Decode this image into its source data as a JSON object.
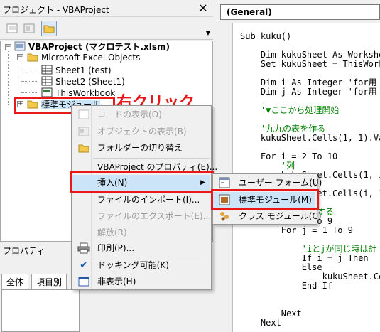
{
  "project_explorer": {
    "title": "プロジェクト - VBAProject",
    "close_glyph": "✕",
    "tree": {
      "root": "VBAProject (マクロテスト.xlsm)",
      "excel_objects_folder": "Microsoft Excel Objects",
      "sheet1": "Sheet1 (test)",
      "sheet2": "Sheet2 (Sheet1)",
      "thisworkbook": "ThisWorkbook",
      "standard_module_folder": "標準モジュール"
    }
  },
  "callout": {
    "text": "右クリック"
  },
  "properties": {
    "title": "プロパティ",
    "tabs": [
      "全体",
      "項目別"
    ]
  },
  "code": {
    "combo": "(General)",
    "lines": [
      {
        "text": "Sub kuku()",
        "cls": ""
      },
      {
        "text": "",
        "cls": ""
      },
      {
        "text": "    Dim kukuSheet As Workshe",
        "cls": ""
      },
      {
        "text": "    Set kukuSheet = ThisWork",
        "cls": ""
      },
      {
        "text": "",
        "cls": ""
      },
      {
        "text": "    Dim i As Integer 'for用",
        "cls": ""
      },
      {
        "text": "    Dim j As Integer 'for用",
        "cls": ""
      },
      {
        "text": "",
        "cls": ""
      },
      {
        "text": "    '▼ここから処理開始",
        "cls": "cm"
      },
      {
        "text": "",
        "cls": ""
      },
      {
        "text": "    '九九の表を作る",
        "cls": "cm"
      },
      {
        "text": "    kukuSheet.Cells(1, 1).Va",
        "cls": ""
      },
      {
        "text": "",
        "cls": ""
      },
      {
        "text": "    For i = 2 To 10",
        "cls": ""
      },
      {
        "text": "        '列",
        "cls": "cm"
      },
      {
        "text": "        kukuSheet.Cells(1, i",
        "cls": ""
      },
      {
        "text": "",
        "cls": ""
      },
      {
        "text": "        kukuSheet.Cells(i, 1",
        "cls": ""
      },
      {
        "text": "",
        "cls": ""
      },
      {
        "text": "    '九九の計算をする",
        "cls": "cm"
      },
      {
        "text": "    For i = 1 To 9",
        "cls": ""
      },
      {
        "text": "        For j = 1 To 9",
        "cls": ""
      },
      {
        "text": "",
        "cls": ""
      },
      {
        "text": "            'iとjが同じ時は計",
        "cls": "cm"
      },
      {
        "text": "            If i = j Then",
        "cls": ""
      },
      {
        "text": "            Else",
        "cls": ""
      },
      {
        "text": "                kukuSheet.Ce",
        "cls": ""
      },
      {
        "text": "            End If",
        "cls": ""
      },
      {
        "text": "",
        "cls": ""
      },
      {
        "text": "",
        "cls": ""
      },
      {
        "text": "        Next",
        "cls": ""
      },
      {
        "text": "    Next",
        "cls": ""
      }
    ]
  },
  "context_menu": {
    "view_code": "コードの表示(O)",
    "view_object": "オブジェクトの表示(B)",
    "toggle_folders": "フォルダーの切り替え",
    "vba_properties": "VBAProject のプロパティ(E)...",
    "insert": "挿入(N)",
    "import_file": "ファイルのインポート(I)...",
    "export_file": "ファイルのエクスポート(E)...",
    "remove": "解放(R)",
    "print": "印刷(P)...",
    "dockable": "ドッキング可能(K)",
    "hide": "非表示(H)"
  },
  "insert_submenu": {
    "userform": "ユーザー フォーム(U)",
    "module": "標準モジュール(M)",
    "class_module": "クラス モジュール(C)"
  },
  "colors": {
    "highlight_red": "#e81919",
    "selection_blue": "#cce4f7"
  }
}
